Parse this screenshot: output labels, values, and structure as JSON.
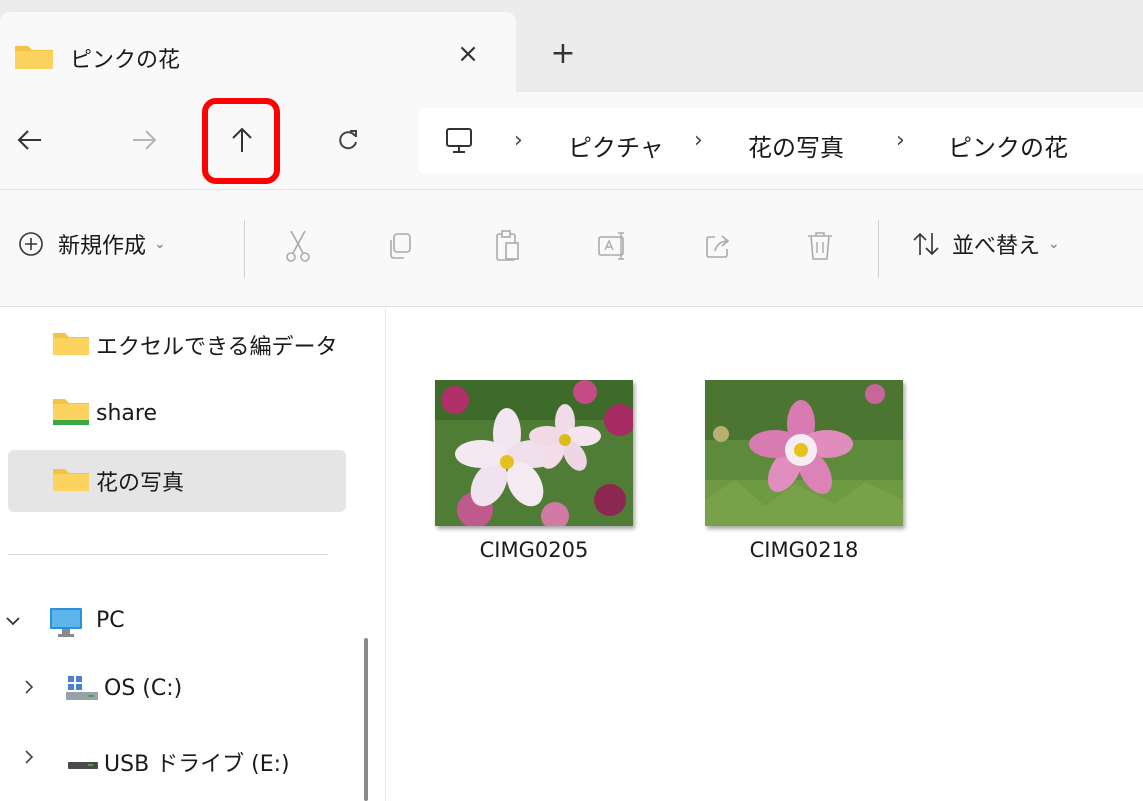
{
  "window": {
    "tab_title": "ピンクの花",
    "tab_close": "×",
    "new_tab": "+"
  },
  "breadcrumb": [
    "ピクチャ",
    "花の写真",
    "ピンクの花"
  ],
  "breadcrumb_separator": "›",
  "toolbar": {
    "new_label": "新規作成",
    "sort_label": "並べ替え",
    "dropdown_chevron": "⌄"
  },
  "sidebar": {
    "folders": [
      {
        "label": "エクセルできる編データ",
        "icon": "folder-icon"
      },
      {
        "label": "share",
        "icon": "shared-folder-icon"
      },
      {
        "label": "花の写真",
        "icon": "folder-icon",
        "selected": true
      }
    ],
    "tree": [
      {
        "label": "PC",
        "icon": "pc-icon",
        "expanded": true,
        "chevron": "✓"
      },
      {
        "label": "OS (C:)",
        "icon": "drive-icon",
        "expanded": false,
        "chevron": "›"
      },
      {
        "label": "USB ドライブ (E:)",
        "icon": "usb-drive-icon",
        "expanded": false,
        "chevron": "›"
      }
    ]
  },
  "files": [
    {
      "name": "CIMG0205",
      "icon": "image-thumbnail"
    },
    {
      "name": "CIMG0218",
      "icon": "image-thumbnail"
    }
  ],
  "colors": {
    "highlight": "#ff0000",
    "folder_yellow": "#f5c244",
    "selected_bg": "#e5e5e5"
  }
}
